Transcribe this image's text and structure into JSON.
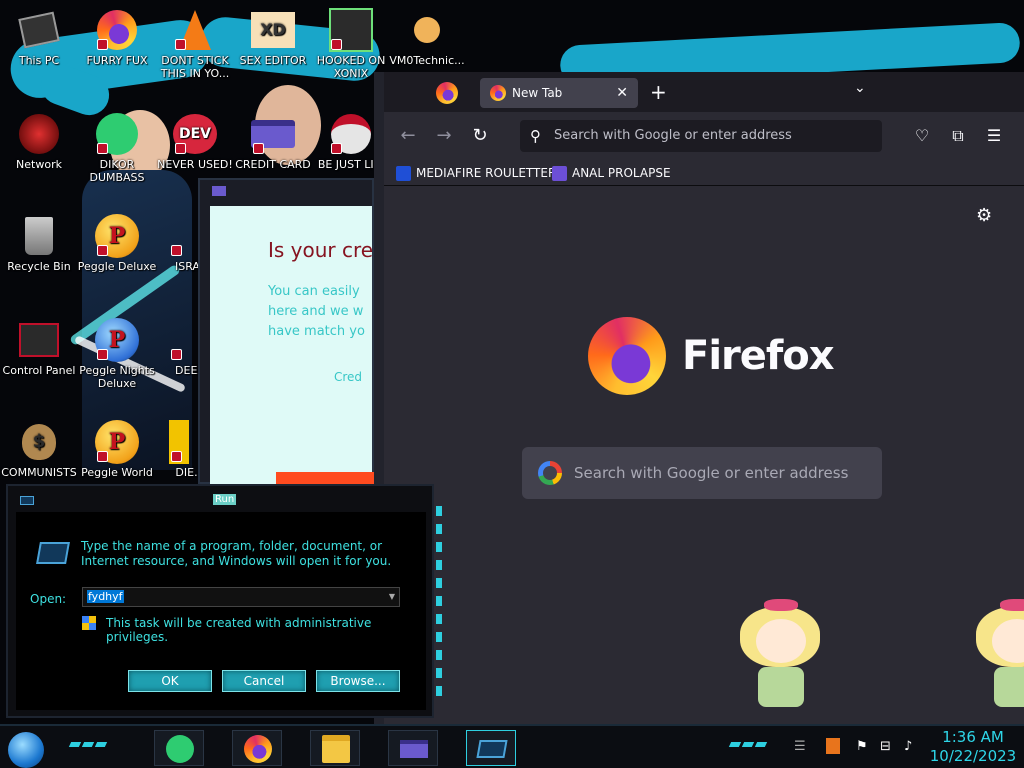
{
  "desktop": {
    "icons": [
      {
        "label": "This PC",
        "icon": "computer-icon"
      },
      {
        "label": "FURRY FUX",
        "icon": "firefox-icon"
      },
      {
        "label": "DONT STICK\nTHIS IN YO...",
        "icon": "vlc-cone-icon"
      },
      {
        "label": "SEX EDITOR",
        "icon": "xd-editor-icon"
      },
      {
        "label": "HOOKED ON\nXONIX",
        "icon": "xonix-game-icon"
      },
      {
        "label": "VM0Technic...",
        "icon": "technician-person-icon"
      },
      {
        "label": "Network",
        "icon": "network-icon"
      },
      {
        "label": "DIKOR\nDUMBASS",
        "icon": "green-chat-icon"
      },
      {
        "label": "NEVER USED!",
        "icon": "dev-badge-icon"
      },
      {
        "label": "CREDIT CARD",
        "icon": "credit-card-icon"
      },
      {
        "label": "BE JUST LI...",
        "icon": "santa-icon"
      },
      {
        "label": "Recycle Bin",
        "icon": "recycle-bin-icon"
      },
      {
        "label": "Peggle Deluxe",
        "icon": "peggle-icon"
      },
      {
        "label": "ISRAI...",
        "icon": "generic-app-icon"
      },
      {
        "label": "Control Panel",
        "icon": "control-panel-icon"
      },
      {
        "label": "Peggle Nights\nDeluxe",
        "icon": "peggle-icon"
      },
      {
        "label": "DEEZ",
        "icon": "generic-app-icon"
      },
      {
        "label": "COMMUNISTS",
        "icon": "money-bag-icon"
      },
      {
        "label": "Peggle World",
        "icon": "peggle-icon"
      },
      {
        "label": "DIE...",
        "icon": "generic-app-icon"
      }
    ]
  },
  "browser": {
    "tab_label": "New Tab",
    "tab_close": "✕",
    "new_tab": "+",
    "tab_list": "⌄",
    "back": "←",
    "forward": "→",
    "reload": "↻",
    "url_placeholder": "Search with Google or enter address",
    "bookmarks": [
      {
        "label": "MEDIAFIRE ROULETTER",
        "icon": "mediafire-icon",
        "color": "#1f4fd6"
      },
      {
        "label": "ANAL PROLAPSE",
        "icon": "visual-studio-icon",
        "color": "#6c4fd6"
      }
    ],
    "brand": "Firefox",
    "search_placeholder": "Search with Google or enter address",
    "colors": {
      "chrome": "#1c1b22",
      "page": "#2b2a33",
      "field": "#42414d"
    }
  },
  "background_window": {
    "title": "Is your cre",
    "body": "You can easily\nhere and we w\nhave match yo",
    "link": "Cred"
  },
  "run_dialog": {
    "title": "Run",
    "description": "Type the name of a program, folder, document, or Internet resource, and Windows will open it for you.",
    "open_label": "Open:",
    "open_value": "fydhyf",
    "admin_note": "This task will be created with administrative privileges.",
    "ok": "OK",
    "cancel": "Cancel",
    "browse": "Browse...",
    "accent": "#3ee0e0"
  },
  "taskbar": {
    "apps": [
      {
        "name": "chat-app",
        "icon": "green-chat-icon"
      },
      {
        "name": "firefox",
        "icon": "firefox-icon"
      },
      {
        "name": "file-explorer",
        "icon": "folder-icon"
      },
      {
        "name": "credit-card",
        "icon": "credit-card-icon"
      },
      {
        "name": "run",
        "icon": "run-icon"
      }
    ],
    "time": "1:36 AM",
    "date": "10/22/2023"
  }
}
